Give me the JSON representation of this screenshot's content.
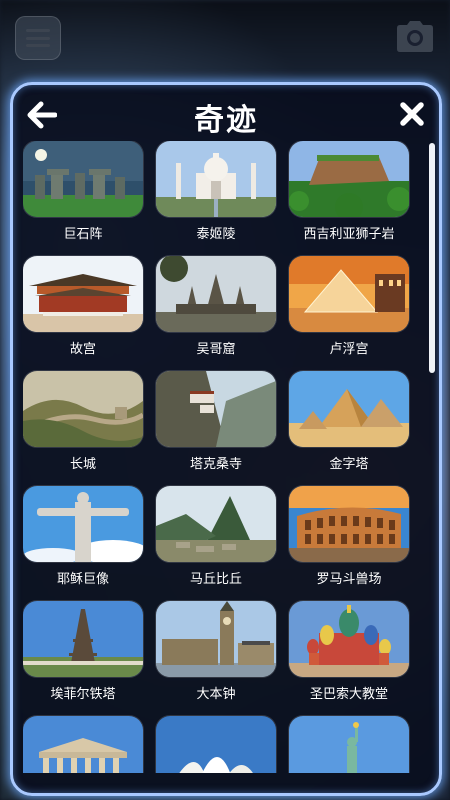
{
  "header": {
    "title": "奇迹",
    "menu_icon": "menu-icon",
    "camera_icon": "camera-icon",
    "back_icon": "arrow-left-icon",
    "close_icon": "close-icon"
  },
  "colors": {
    "panel_border": "#a9c9ff",
    "glow": "#6eaaff",
    "panel_bg": "#080c1c",
    "text": "#ffffff"
  },
  "wonders": [
    {
      "label": "巨石阵",
      "scene": "stonehenge"
    },
    {
      "label": "泰姬陵",
      "scene": "tajmahal"
    },
    {
      "label": "西吉利亚狮子岩",
      "scene": "sigiriya"
    },
    {
      "label": "故宫",
      "scene": "forbidden"
    },
    {
      "label": "吴哥窟",
      "scene": "angkor"
    },
    {
      "label": "卢浮宫",
      "scene": "louvre"
    },
    {
      "label": "长城",
      "scene": "greatwall"
    },
    {
      "label": "塔克桑寺",
      "scene": "taktsang"
    },
    {
      "label": "金字塔",
      "scene": "pyramids"
    },
    {
      "label": "耶稣巨像",
      "scene": "redeemer"
    },
    {
      "label": "马丘比丘",
      "scene": "machupicchu"
    },
    {
      "label": "罗马斗兽场",
      "scene": "colosseum"
    },
    {
      "label": "埃菲尔铁塔",
      "scene": "eiffel"
    },
    {
      "label": "大本钟",
      "scene": "bigben"
    },
    {
      "label": "圣巴索大教堂",
      "scene": "stbasil"
    },
    {
      "label": "",
      "scene": "parthenon"
    },
    {
      "label": "",
      "scene": "opera"
    },
    {
      "label": "",
      "scene": "liberty"
    }
  ]
}
